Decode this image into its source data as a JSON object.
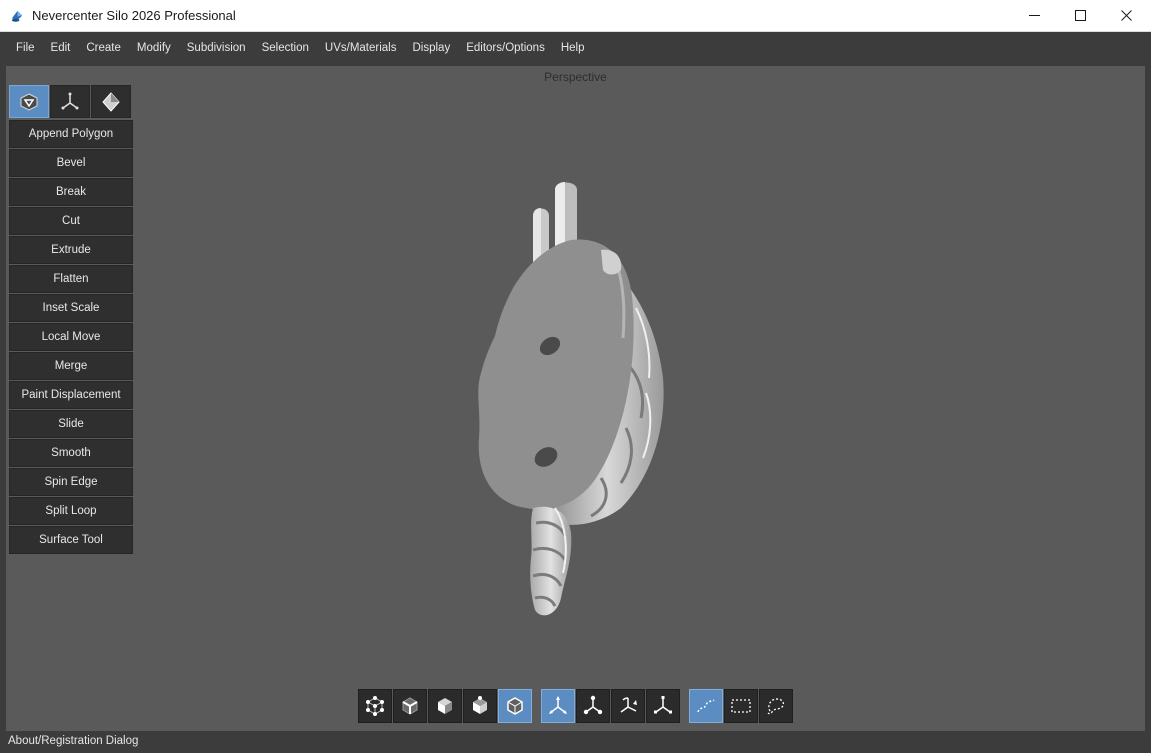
{
  "window": {
    "title": "Nevercenter Silo 2026 Professional",
    "icons": [
      "app-icon",
      "minimize-icon",
      "maximize-icon",
      "close-icon"
    ]
  },
  "menu": {
    "items": [
      "File",
      "Edit",
      "Create",
      "Modify",
      "Subdivision",
      "Selection",
      "UVs/Materials",
      "Display",
      "Editors/Options",
      "Help"
    ]
  },
  "viewport": {
    "label": "Perspective",
    "background": "#5a5a5a"
  },
  "toolpanel": {
    "modes": [
      {
        "icon": "polygon-tools-icon",
        "active": true
      },
      {
        "icon": "transform-tools-icon",
        "active": false
      },
      {
        "icon": "sculpt-tools-icon",
        "active": false
      }
    ],
    "tools": [
      "Append Polygon",
      "Bevel",
      "Break",
      "Cut",
      "Extrude",
      "Flatten",
      "Inset Scale",
      "Local Move",
      "Merge",
      "Paint Displacement",
      "Slide",
      "Smooth",
      "Spin Edge",
      "Split Loop",
      "Surface Tool"
    ]
  },
  "bottom_toolbar": {
    "selection_modes": [
      {
        "icon": "vertex-select-icon",
        "active": false
      },
      {
        "icon": "edge-select-icon",
        "active": false
      },
      {
        "icon": "face-select-icon",
        "active": false
      },
      {
        "icon": "multi-select-icon",
        "active": false
      },
      {
        "icon": "object-select-icon",
        "active": true
      }
    ],
    "manipulators": [
      {
        "icon": "move-manipulator-icon",
        "active": true
      },
      {
        "icon": "universal-manipulator-icon",
        "active": false
      },
      {
        "icon": "rotate-manipulator-icon",
        "active": false
      },
      {
        "icon": "scale-manipulator-icon",
        "active": false
      }
    ],
    "selection_shapes": [
      {
        "icon": "paint-select-icon",
        "active": true
      },
      {
        "icon": "rectangle-select-icon",
        "active": false
      },
      {
        "icon": "lasso-select-icon",
        "active": false
      }
    ]
  },
  "status": {
    "text": "About/Registration Dialog"
  },
  "colors": {
    "accent": "#5b8cc2",
    "panel": "#2f2f2f",
    "chrome": "#3c3c3c"
  }
}
